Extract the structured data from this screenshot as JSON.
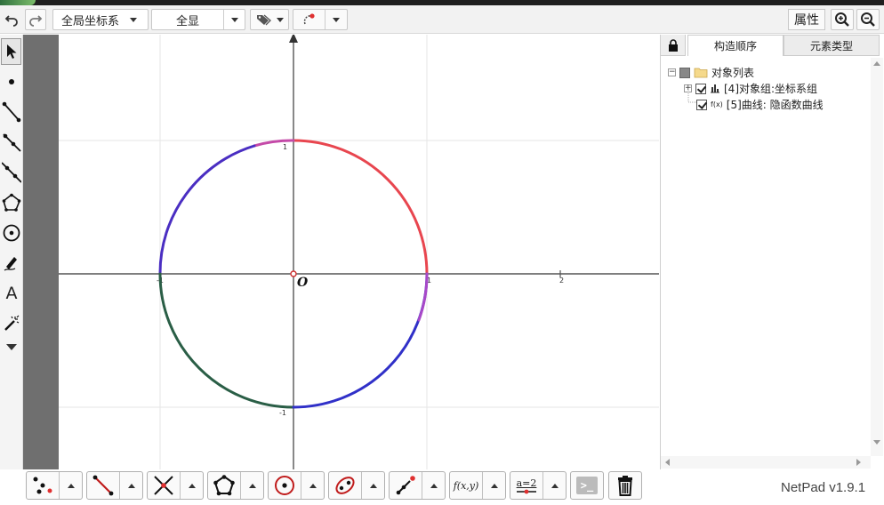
{
  "toolbar": {
    "undo_icon": "undo-icon",
    "redo_icon": "redo-icon",
    "coordinate_system_select": "全局坐标系",
    "view_select": "全显",
    "attributes_button": "属性",
    "zoom_in_icon": "zoom-in-icon",
    "zoom_out_icon": "zoom-out-icon"
  },
  "left_tools": [
    "pointer-arrow-icon",
    "point-icon",
    "segment-icon",
    "ray-icon",
    "line-icon",
    "polygon-icon",
    "circle-icon",
    "pen-icon",
    "text-icon",
    "magic-wand-icon",
    "more-icon"
  ],
  "canvas": {
    "origin_label": "O",
    "x_ticks": [
      "-1",
      "1",
      "2"
    ],
    "y_ticks": [
      "1",
      "-1"
    ],
    "curve_colors": [
      "#e8464f",
      "#b848c0",
      "#3030c8",
      "#2a5e46"
    ]
  },
  "panel": {
    "tabs": [
      "构造顺序",
      "元素类型"
    ],
    "active_tab": "构造顺序",
    "tree": {
      "root_label": "对象列表",
      "items": [
        {
          "label": "[4]对象组:坐标系组",
          "type_icon": "bar-chart-icon",
          "checked": true,
          "expandable": true
        },
        {
          "label": "[5]曲线: 隐函数曲线",
          "type_icon_text": "f(x)",
          "checked": true,
          "expandable": false
        }
      ]
    }
  },
  "bottom_tools": [
    "points-tool",
    "segment-tool",
    "intersection-tool",
    "polygon-tool",
    "circle-tool",
    "conic-tool",
    "vector-tool",
    "function-tool",
    "parameter-tool",
    "command-tool",
    "delete-tool"
  ],
  "bottom_labels": {
    "function": "f(x,y)",
    "parameter": "a=2",
    "command": ">_"
  },
  "version": "NetPad v1.9.1"
}
